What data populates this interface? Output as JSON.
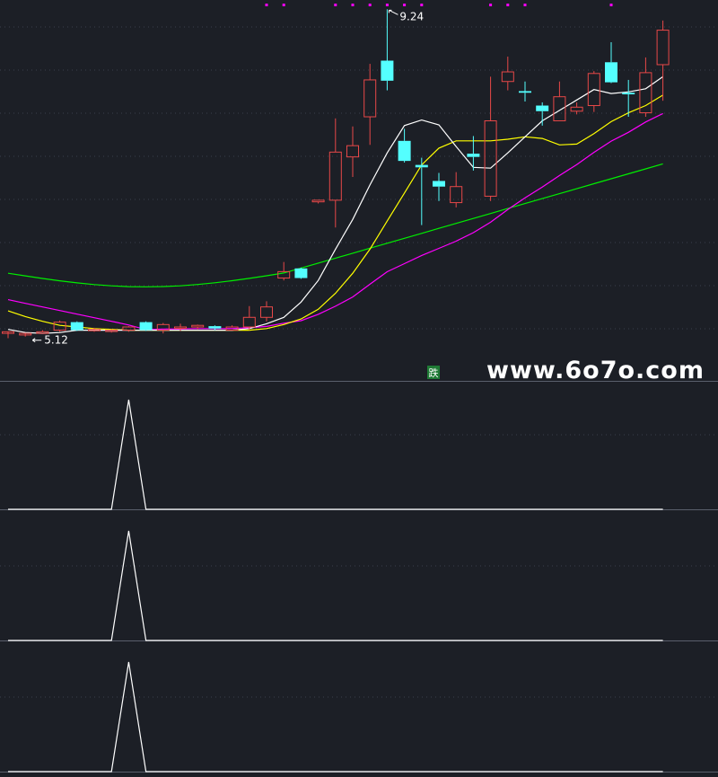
{
  "chart_data": [
    {
      "type": "candlestick",
      "title": "",
      "ylim": [
        5.0,
        9.3
      ],
      "annotations": {
        "high_label": "9.24",
        "low_label": "5.12"
      },
      "tag_label": "跌",
      "watermark": "www.6o7o.com",
      "colors": {
        "up": "#e84848",
        "down": "#54ffff",
        "ma5": "#ffffff",
        "ma10": "#ffff00",
        "ma20": "#ff00ff",
        "ma60": "#00ee00",
        "signal_dots": "#ff00ff"
      },
      "candles": [
        [
          5.2,
          5.22,
          5.16,
          5.14
        ],
        [
          5.18,
          5.2,
          5.17,
          5.16
        ],
        [
          5.2,
          5.22,
          5.24,
          5.2
        ],
        [
          5.24,
          5.34,
          5.36,
          5.22
        ],
        [
          5.34,
          5.24,
          5.35,
          5.23
        ],
        [
          5.24,
          5.25,
          5.27,
          5.22
        ],
        [
          5.23,
          5.24,
          5.25,
          5.21
        ],
        [
          5.24,
          5.28,
          5.29,
          5.22
        ],
        [
          5.34,
          5.24,
          5.35,
          5.23
        ],
        [
          5.24,
          5.31,
          5.33,
          5.2
        ],
        [
          5.27,
          5.28,
          5.32,
          5.23
        ],
        [
          5.28,
          5.3,
          5.31,
          5.25
        ],
        [
          5.29,
          5.26,
          5.3,
          5.24
        ],
        [
          5.24,
          5.28,
          5.3,
          5.24
        ],
        [
          5.28,
          5.4,
          5.54,
          5.24
        ],
        [
          5.4,
          5.53,
          5.6,
          5.35
        ],
        [
          5.89,
          5.97,
          6.09,
          5.86
        ],
        [
          6.01,
          5.89,
          6.02,
          5.88
        ],
        [
          6.84,
          6.86,
          6.86,
          6.82
        ],
        [
          6.86,
          7.46,
          7.88,
          6.52
        ],
        [
          7.4,
          7.54,
          7.78,
          7.15
        ],
        [
          7.9,
          8.36,
          8.56,
          7.55
        ],
        [
          8.6,
          8.35,
          9.24,
          8.23
        ],
        [
          7.6,
          7.35,
          7.75,
          7.33
        ],
        [
          7.3,
          7.27,
          7.39,
          6.55
        ],
        [
          7.1,
          7.03,
          7.2,
          6.85
        ],
        [
          6.83,
          7.03,
          7.21,
          6.77
        ],
        [
          7.44,
          7.4,
          7.66,
          7.23
        ],
        [
          6.91,
          7.85,
          8.4,
          6.85
        ],
        [
          8.34,
          8.46,
          8.65,
          8.23
        ],
        [
          8.22,
          8.2,
          8.34,
          8.09
        ],
        [
          8.04,
          7.97,
          8.08,
          7.79
        ],
        [
          7.85,
          8.15,
          8.34,
          7.85
        ],
        [
          7.97,
          8.02,
          8.08,
          7.93
        ],
        [
          8.04,
          8.44,
          8.47,
          7.96
        ],
        [
          8.58,
          8.33,
          8.83,
          8.32
        ],
        [
          8.2,
          8.18,
          8.36,
          7.9
        ],
        [
          7.95,
          8.45,
          8.64,
          7.9
        ],
        [
          8.55,
          8.98,
          9.1,
          8.1
        ]
      ],
      "ma5": [
        5.25,
        5.21,
        5.2,
        5.21,
        5.24,
        5.24,
        5.24,
        5.24,
        5.24,
        5.24,
        5.24,
        5.24,
        5.24,
        5.24,
        5.26,
        5.32,
        5.4,
        5.59,
        5.86,
        6.25,
        6.62,
        7.05,
        7.45,
        7.79,
        7.86,
        7.8,
        7.53,
        7.27,
        7.26,
        7.45,
        7.65,
        7.85,
        7.98,
        8.11,
        8.24,
        8.19,
        8.21,
        8.25,
        8.4
      ],
      "ma10": [
        5.48,
        5.41,
        5.35,
        5.3,
        5.28,
        5.26,
        5.25,
        5.24,
        5.24,
        5.24,
        5.24,
        5.24,
        5.24,
        5.24,
        5.24,
        5.26,
        5.31,
        5.38,
        5.5,
        5.7,
        5.95,
        6.25,
        6.6,
        6.95,
        7.3,
        7.51,
        7.6,
        7.6,
        7.6,
        7.62,
        7.65,
        7.63,
        7.55,
        7.56,
        7.69,
        7.84,
        7.95,
        8.04,
        8.17
      ]
    },
    {
      "type": "line",
      "title": "",
      "ylim": [
        0,
        1
      ],
      "values": [
        0,
        0,
        0,
        0,
        0,
        0,
        0,
        1,
        0,
        0,
        0,
        0,
        0,
        0,
        0,
        0,
        0,
        0,
        0,
        0,
        0,
        0,
        0,
        0,
        0,
        0,
        0,
        0,
        0,
        0,
        0,
        0,
        0,
        0,
        0,
        0,
        0,
        0,
        0
      ],
      "colors": {
        "line": "#ffffff"
      }
    },
    {
      "type": "line",
      "title": "",
      "ylim": [
        0,
        1
      ],
      "values": [
        0,
        0,
        0,
        0,
        0,
        0,
        0,
        1,
        0,
        0,
        0,
        0,
        0,
        0,
        0,
        0,
        0,
        0,
        0,
        0,
        0,
        0,
        0,
        0,
        0,
        0,
        0,
        0,
        0,
        0,
        0,
        0,
        0,
        0,
        0,
        0,
        0,
        0,
        0
      ],
      "colors": {
        "line": "#ffffff"
      }
    },
    {
      "type": "line",
      "title": "",
      "ylim": [
        0,
        1
      ],
      "values": [
        0,
        0,
        0,
        0,
        0,
        0,
        0,
        1,
        0,
        0,
        0,
        0,
        0,
        0,
        0,
        0,
        0,
        0,
        0,
        0,
        0,
        0,
        0,
        0,
        0,
        0,
        0,
        0,
        0,
        0,
        0,
        0,
        0,
        0,
        0,
        0,
        0,
        0,
        0
      ],
      "colors": {
        "line": "#ffffff"
      }
    }
  ]
}
